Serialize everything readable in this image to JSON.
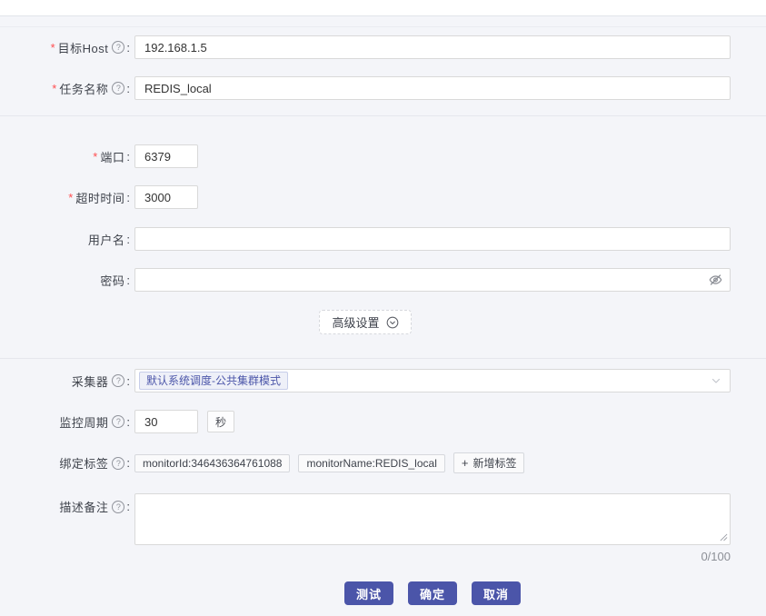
{
  "page": {
    "background": "#f4f5f9",
    "accent_color": "#4b55a9",
    "required_color": "#ff4d4f"
  },
  "misc": {
    "required_mark": "*",
    "colon": ":",
    "help_glyph": "?",
    "plus_glyph": "+"
  },
  "form": {
    "host": {
      "label": "目标Host",
      "value": "192.168.1.5"
    },
    "name": {
      "label": "任务名称",
      "value": "REDIS_local"
    },
    "port": {
      "label": "端口",
      "value": "6379"
    },
    "timeout": {
      "label": "超时时间",
      "value": "3000"
    },
    "username": {
      "label": "用户名",
      "value": ""
    },
    "password": {
      "label": "密码",
      "value": ""
    },
    "advanced": {
      "label": "高级设置"
    },
    "collector": {
      "label": "采集器",
      "selected_tag": "默认系统调度-公共集群模式"
    },
    "interval": {
      "label": "监控周期",
      "value": "30",
      "unit": "秒"
    },
    "tags": {
      "label": "绑定标签",
      "items": [
        "monitorId:346436364761088",
        "monitorName:REDIS_local"
      ],
      "add_label": "新增标签"
    },
    "description": {
      "label": "描述备注",
      "value": "",
      "counter": "0/100"
    }
  },
  "buttons": {
    "test": "测试",
    "confirm": "确定",
    "cancel": "取消"
  }
}
